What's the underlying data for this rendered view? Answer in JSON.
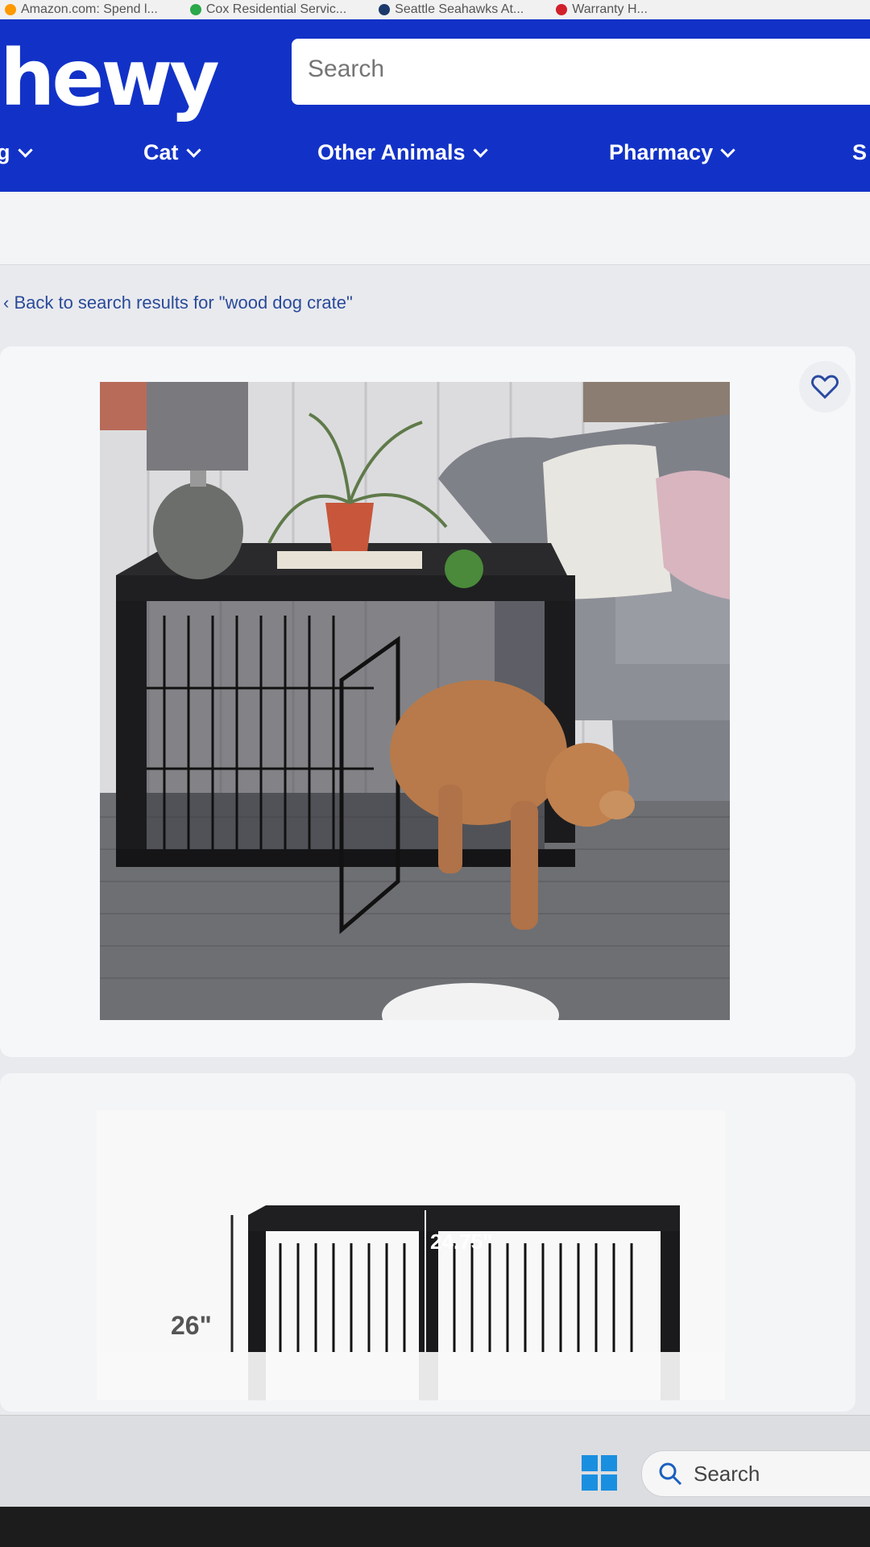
{
  "bookmarks": [
    {
      "label": "Amazon.com: Spend l...",
      "color": "#ff9900"
    },
    {
      "label": "Cox Residential Servic...",
      "color": "#2aa84a"
    },
    {
      "label": "Seattle Seahawks At...",
      "color": "#1b3a6b"
    },
    {
      "label": "Warranty H...",
      "color": "#d0202a"
    }
  ],
  "header": {
    "logo": "hewy",
    "search_placeholder": "Search",
    "nav": [
      {
        "label": "g"
      },
      {
        "label": "Cat"
      },
      {
        "label": "Other Animals"
      },
      {
        "label": "Pharmacy"
      },
      {
        "label": "S"
      }
    ]
  },
  "breadcrumb": {
    "back_text": "Back to search results for \"wood dog crate\""
  },
  "product": {
    "main_image": "dog-crate-photo",
    "favorite_icon": "heart-icon"
  },
  "dimension_image": {
    "height_label": "26\"",
    "depth_label": "24.75\""
  },
  "taskbar": {
    "search_label": "Search"
  },
  "colors": {
    "brand_blue": "#1232c7",
    "link_blue": "#2a4a9a",
    "heart_blue": "#2a4aa0"
  }
}
